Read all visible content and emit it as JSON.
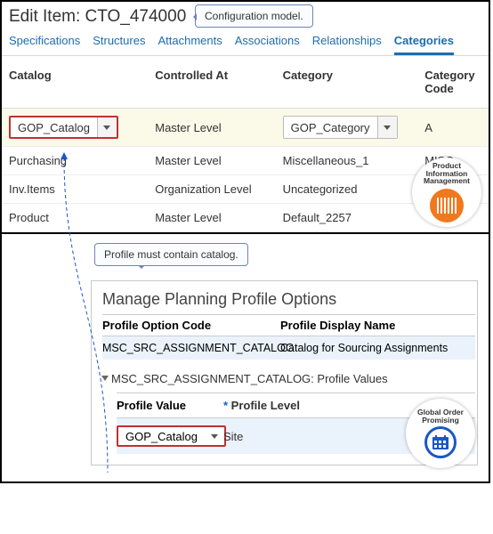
{
  "header": {
    "title": "Edit Item: CTO_474000",
    "callout": "Configuration model."
  },
  "tabs": [
    {
      "label": "Specifications",
      "active": false
    },
    {
      "label": "Structures",
      "active": false
    },
    {
      "label": "Attachments",
      "active": false
    },
    {
      "label": "Associations",
      "active": false
    },
    {
      "label": "Relationships",
      "active": false
    },
    {
      "label": "Categories",
      "active": true
    }
  ],
  "grid": {
    "columns": {
      "catalog": "Catalog",
      "controlled": "Controlled At",
      "category": "Category",
      "code": "Category Code"
    },
    "rows": [
      {
        "catalog": "GOP_Catalog",
        "controlled": "Master Level",
        "category": "GOP_Category",
        "code": "A",
        "selected": true,
        "catalog_dd": true,
        "category_dd": true
      },
      {
        "catalog": "Purchasing",
        "controlled": "Master Level",
        "category": "Miscellaneous_1",
        "code": "MISC....",
        "selected": false
      },
      {
        "catalog": "Inv.Items",
        "controlled": "Organization Level",
        "category": "Uncategorized",
        "code": "",
        "selected": false
      },
      {
        "catalog": "Product",
        "controlled": "Master Level",
        "category": "Default_2257",
        "code": "",
        "selected": false
      }
    ]
  },
  "pim_badge": {
    "line1": "Product",
    "line2": "Information",
    "line3": "Management"
  },
  "profile_callout": "Profile must contain catalog.",
  "profile": {
    "title": "Manage Planning Profile Options",
    "col1": "Profile Option Code",
    "col2": "Profile Display Name",
    "row_code": "MSC_SRC_ASSIGNMENT_CATALOG",
    "row_name": "Catalog for Sourcing Assignments",
    "subhead": "MSC_SRC_ASSIGNMENT_CATALOG: Profile Values",
    "pv_col1": "Profile Value",
    "pv_col2": "Profile Level",
    "pv_value": "GOP_Catalog",
    "pv_level": "Site"
  },
  "gop_badge": {
    "line1": "Global Order",
    "line2": "Promising"
  }
}
